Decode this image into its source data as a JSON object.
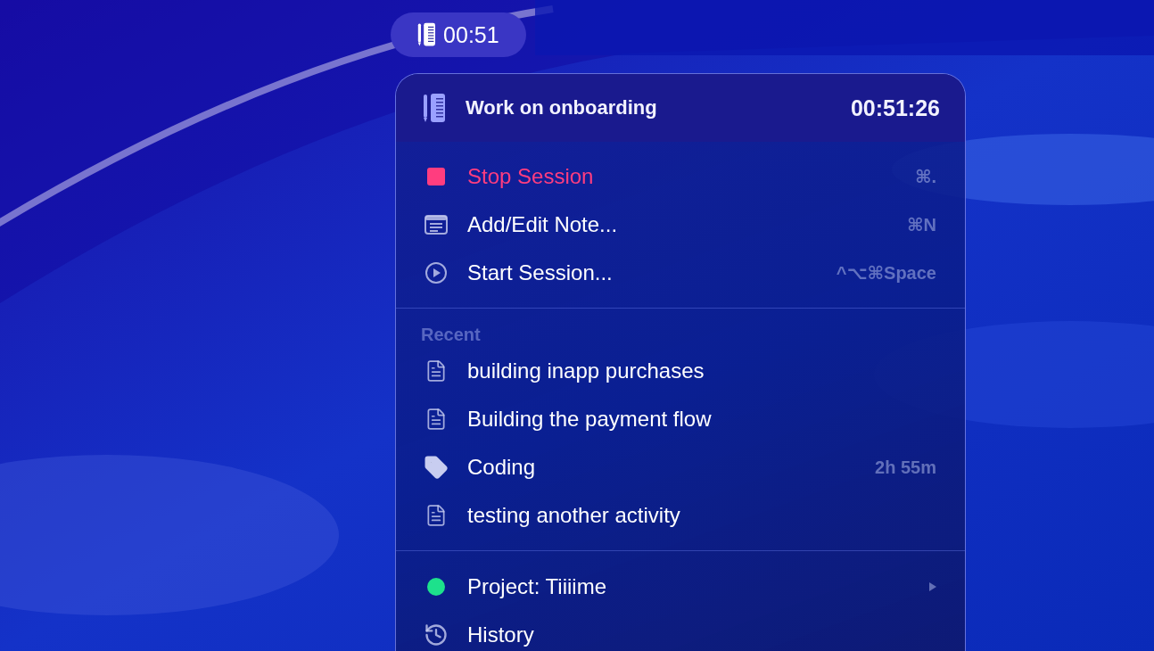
{
  "menubar": {
    "timer": "00:51"
  },
  "header": {
    "title": "Work on onboarding",
    "elapsed": "00:51:26"
  },
  "actions": [
    {
      "kind": "stop",
      "label": "Stop Session",
      "shortcut": "⌘."
    },
    {
      "kind": "note",
      "label": "Add/Edit Note...",
      "shortcut": "⌘N"
    },
    {
      "kind": "play",
      "label": "Start Session...",
      "shortcut": "^⌥⌘Space"
    }
  ],
  "recent": {
    "heading": "Recent",
    "items": [
      {
        "kind": "document",
        "label": "building inapp purchases"
      },
      {
        "kind": "document",
        "label": "Building the payment flow"
      },
      {
        "kind": "tag",
        "label": "Coding",
        "duration": "2h 55m"
      },
      {
        "kind": "document",
        "label": "testing another activity"
      }
    ]
  },
  "footer": [
    {
      "kind": "project",
      "label": "Project: Tiiiime",
      "color": "#1de18c",
      "submenu": true
    },
    {
      "kind": "history",
      "label": "History",
      "submenu": false
    }
  ]
}
